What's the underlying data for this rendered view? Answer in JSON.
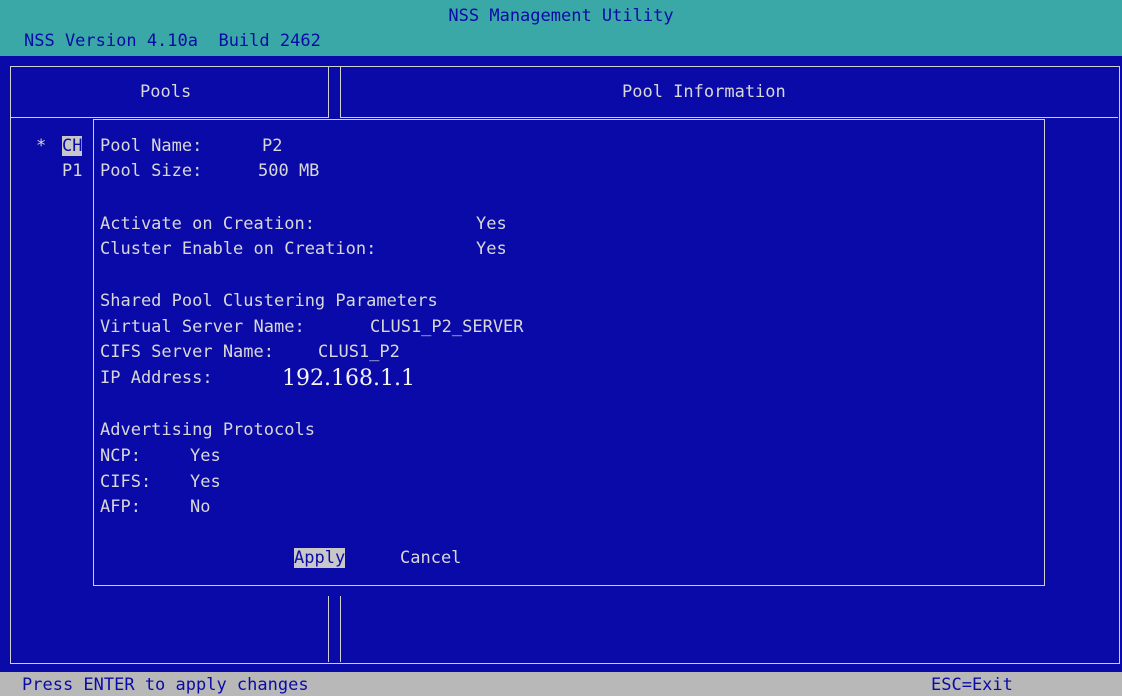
{
  "header": {
    "title": "NSS Management Utility",
    "version": "NSS Version 4.10a  Build 2462"
  },
  "pools_panel": {
    "title": "Pools",
    "items": [
      {
        "marker": "*",
        "label": "CH",
        "selected": true
      },
      {
        "marker": "",
        "label": "P1",
        "selected": false
      }
    ]
  },
  "info_panel": {
    "title": "Pool Information"
  },
  "dialog": {
    "pool_name_label": "Pool Name:",
    "pool_name_value": "P2",
    "pool_size_label": "Pool Size:",
    "pool_size_value": "500 MB",
    "activate_label": "Activate on Creation:",
    "activate_value": "Yes",
    "cluster_label": "Cluster Enable on Creation:",
    "cluster_value": "Yes",
    "clustering_heading": "Shared Pool Clustering Parameters",
    "vserver_label": "Virtual Server Name:",
    "vserver_value": "CLUS1_P2_SERVER",
    "cifs_name_label": "CIFS Server Name:",
    "cifs_name_value": "CLUS1_P2",
    "ip_label": "IP Address:",
    "ip_value": "192.168.1.1",
    "protocols_heading": "Advertising Protocols",
    "ncp_label": "NCP:",
    "ncp_value": "Yes",
    "cifs_label": "CIFS:",
    "cifs_value": "Yes",
    "afp_label": "AFP:",
    "afp_value": "No",
    "apply_label": "Apply",
    "cancel_label": "Cancel"
  },
  "status": {
    "hint": "Press ENTER to apply changes",
    "exit": "ESC=Exit"
  },
  "colors": {
    "background": "#0a0aa8",
    "titlebar": "#3aa8a6",
    "statusbar": "#b8b8b8",
    "text": "#d8d8d8"
  }
}
